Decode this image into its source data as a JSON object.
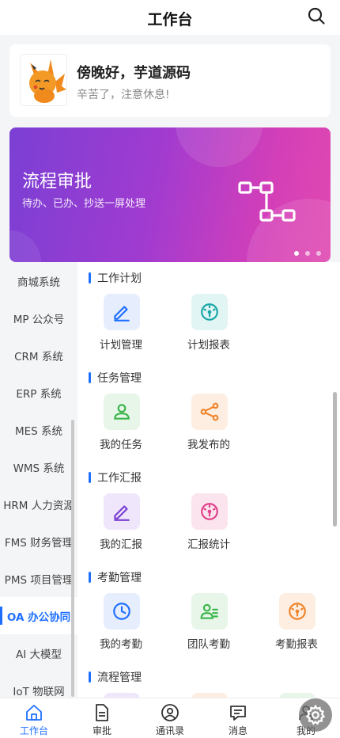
{
  "header": {
    "title": "工作台"
  },
  "greeting": {
    "title": "傍晚好，芋道源码",
    "subtitle": "辛苦了，注意休息!"
  },
  "banner": {
    "title": "流程审批",
    "subtitle": "待办、已办、抄送一屏处理",
    "dots": 3,
    "active_dot": 0
  },
  "sidebar": {
    "items": [
      {
        "label": "商城系统"
      },
      {
        "label": "MP 公众号"
      },
      {
        "label": "CRM 系统"
      },
      {
        "label": "ERP 系统"
      },
      {
        "label": "MES 系统"
      },
      {
        "label": "WMS 系统"
      },
      {
        "label": "HRM 人力资源"
      },
      {
        "label": "FMS 财务管理"
      },
      {
        "label": "PMS 项目管理"
      },
      {
        "label": "OA 办公协同"
      },
      {
        "label": "AI 大模型"
      },
      {
        "label": "IoT 物联网"
      }
    ],
    "active": "OA 办公协同"
  },
  "sections": [
    {
      "title": "工作计划",
      "items": [
        {
          "label": "计划管理",
          "icon": "edit-icon"
        },
        {
          "label": "计划报表",
          "icon": "dashboard-icon"
        }
      ]
    },
    {
      "title": "任务管理",
      "items": [
        {
          "label": "我的任务",
          "icon": "user-icon"
        },
        {
          "label": "我发布的",
          "icon": "share-icon"
        }
      ]
    },
    {
      "title": "工作汇报",
      "items": [
        {
          "label": "我的汇报",
          "icon": "edit-icon"
        },
        {
          "label": "汇报统计",
          "icon": "dashboard-icon"
        }
      ]
    },
    {
      "title": "考勤管理",
      "items": [
        {
          "label": "我的考勤",
          "icon": "clock-icon"
        },
        {
          "label": "团队考勤",
          "icon": "team-icon"
        },
        {
          "label": "考勤报表",
          "icon": "dashboard-icon"
        }
      ]
    },
    {
      "title": "流程管理",
      "items": []
    }
  ],
  "tabs": [
    {
      "label": "工作台",
      "icon": "home-icon",
      "active": true
    },
    {
      "label": "审批",
      "icon": "document-icon"
    },
    {
      "label": "通讯录",
      "icon": "contacts-icon"
    },
    {
      "label": "消息",
      "icon": "message-icon"
    },
    {
      "label": "我的",
      "icon": "profile-icon"
    }
  ],
  "colors": {
    "accent": "#1f6fff",
    "icon_blue": "#1f6fff",
    "bg_blue": "#e6eefe",
    "icon_teal": "#19a6a6",
    "bg_teal": "#e1f5f4",
    "icon_green": "#3ab54a",
    "bg_green": "#e7f6e9",
    "icon_orange": "#f0842b",
    "bg_orange": "#fdeee1",
    "icon_purple": "#7a3fd0",
    "bg_purple": "#efe6fb",
    "icon_pink": "#e0418a",
    "bg_pink": "#fce4ef"
  }
}
